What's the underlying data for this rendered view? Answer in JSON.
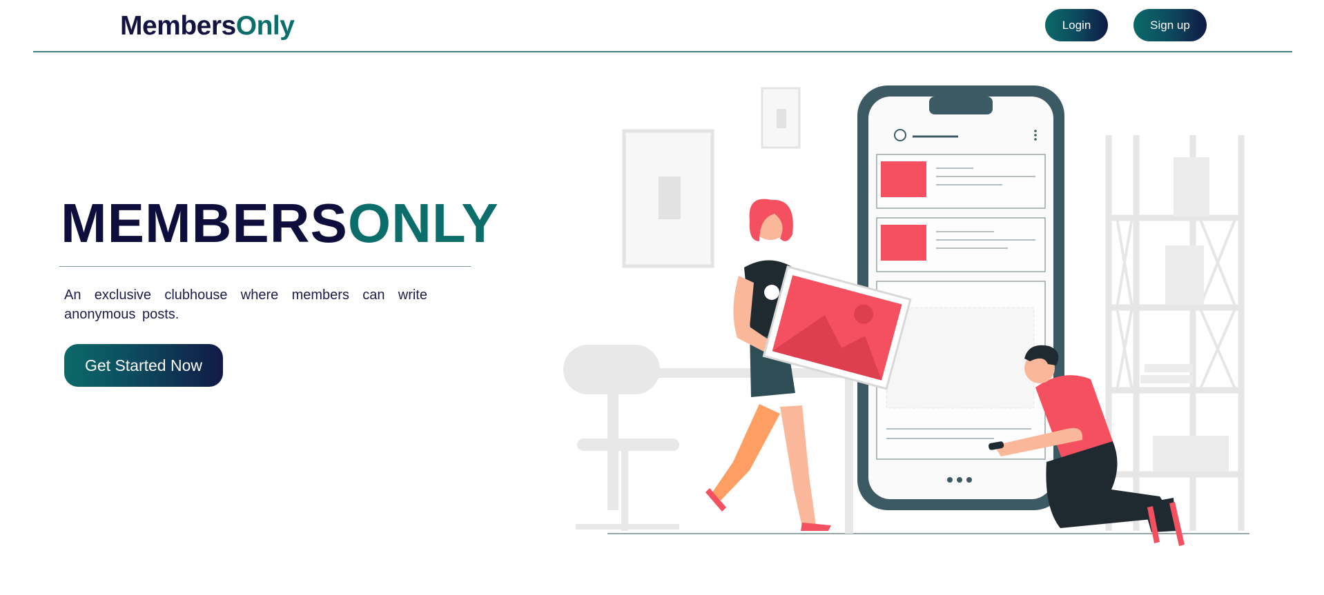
{
  "header": {
    "logo_part1": "Members",
    "logo_part2": "Only",
    "login_label": "Login",
    "signup_label": "Sign up"
  },
  "hero": {
    "title_part1": "MEMBERS",
    "title_part2": "ONLY",
    "description": "An exclusive clubhouse where members can write anonymous posts.",
    "cta_label": "Get Started Now"
  },
  "colors": {
    "navy": "#0e0e3c",
    "teal": "#0c6e6b",
    "accent_red": "#f4505f",
    "phone_frame": "#3b5a63"
  }
}
